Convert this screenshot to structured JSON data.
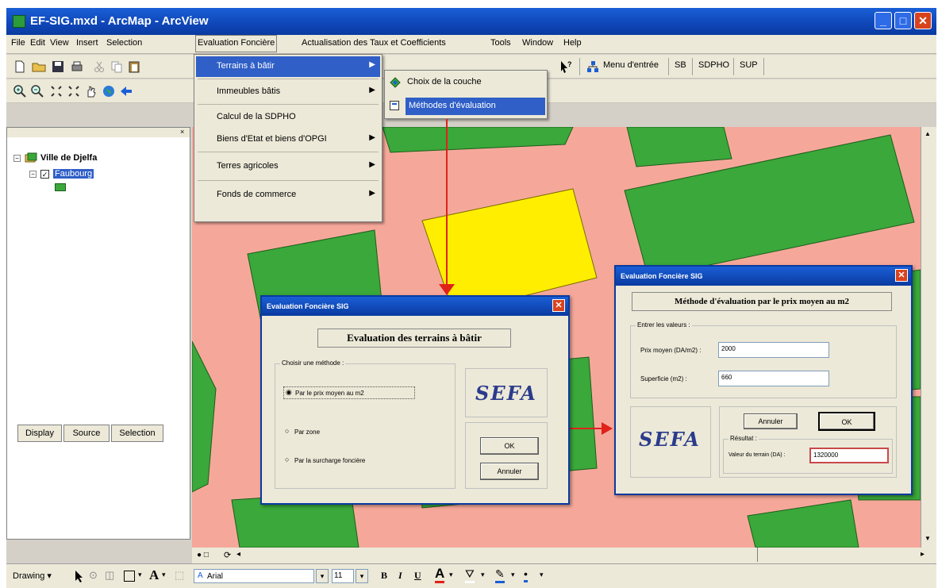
{
  "window": {
    "title": "EF-SIG.mxd - ArcMap - ArcView"
  },
  "menubar": [
    "File",
    "Edit",
    "View",
    "Insert",
    "Selection",
    "Evaluation Foncière",
    "Actualisation des Taux et Coefficients",
    "Tools",
    "Window",
    "Help"
  ],
  "toolbar": {
    "menu_entree": "Menu d'entrée",
    "sb": "SB",
    "sdpho": "SDPHO",
    "sup": "SUP"
  },
  "dropdown": {
    "items": [
      {
        "label": "Terrains à bâtir",
        "submenu": true
      },
      {
        "label": "Immeubles bâtis",
        "submenu": true
      },
      {
        "label": "Calcul de la SDPHO",
        "submenu": false
      },
      {
        "label": "Biens d'Etat et biens d'OPGI",
        "submenu": true
      },
      {
        "label": "Terres agricoles",
        "submenu": true
      },
      {
        "label": "Fonds de commerce",
        "submenu": true
      }
    ],
    "submenu": [
      {
        "label": "Choix de la couche"
      },
      {
        "label": "Méthodes d'évaluation"
      }
    ]
  },
  "toc": {
    "root": "Ville de Djelfa",
    "layer": "Faubourg",
    "tabs": [
      "Display",
      "Source",
      "Selection"
    ]
  },
  "dialog1": {
    "title": "Evaluation Foncière SIG",
    "heading": "Evaluation des terrains à bâtir",
    "group_label": "Choisir une méthode :",
    "options": [
      "Par le prix moyen au m2",
      "Par zone",
      "Par la surcharge foncière"
    ],
    "logo": "SEFA",
    "ok": "OK",
    "cancel": "Annuler"
  },
  "dialog2": {
    "title": "Evaluation Foncière SIG",
    "heading": "Méthode d'évaluation par le prix moyen au m2",
    "group_label": "Entrer les valeurs :",
    "price_label": "Prix moyen (DA/m2) :",
    "price_value": "2000",
    "area_label": "Superficie (m2) :",
    "area_value": "660",
    "logo": "SEFA",
    "cancel": "Annuler",
    "ok": "OK",
    "result_label": "Résultat :",
    "value_label": "Valeur du terrain (DA) :",
    "value": "1320000"
  },
  "drawbar": {
    "drawing": "Drawing",
    "font": "Arial",
    "size": "11",
    "bold": "B",
    "italic": "I",
    "underline": "U"
  },
  "colors": {
    "parcel_green": "#3aa83a",
    "selected_parcel": "#ffee00",
    "background_pink": "#f5a89a",
    "titlebar_blue": "#0f46b8",
    "arrow_red": "#e0221a"
  }
}
